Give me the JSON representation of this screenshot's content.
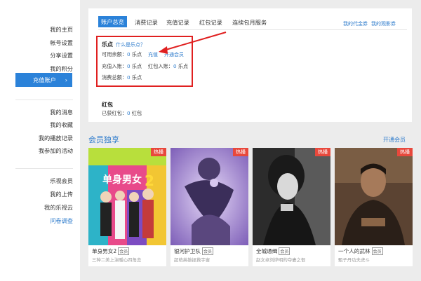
{
  "sidebar": {
    "group1": [
      "我的主页",
      "帐号设置",
      "分享设置",
      "我的积分"
    ],
    "active": "充值账户",
    "group2": [
      "我的消息",
      "我的收藏",
      "我的播放记录",
      "我参加的活动"
    ],
    "group3": [
      "乐视会员",
      "我的上传",
      "我的乐视云",
      "问卷调查"
    ]
  },
  "tabs": [
    "账户总览",
    "消费记录",
    "充值记录",
    "红包记录",
    "连续包月服务"
  ],
  "right_links": [
    "我的代金券",
    "我的观影券"
  ],
  "ledian": {
    "title": "乐点",
    "what": "什么是乐点？",
    "avail_label": "可用余额：",
    "avail_value": "0",
    "unit": "乐点",
    "recharge": "充值",
    "open_vip": "开通会员",
    "recharge_in_label": "充值入账：",
    "recharge_in_value": "0",
    "hongbao_in_label": "红包入账：",
    "hongbao_in_value": "0",
    "consume_label": "消费总额：",
    "consume_value": "0"
  },
  "hongbao": {
    "title": "红包",
    "got_label": "已获红包：",
    "got_value": "0",
    "unit": "红包"
  },
  "vip": {
    "title": "会员独享",
    "link": "开通会员",
    "hot": "热播",
    "member": "会员",
    "posters": [
      {
        "title": "单身男女2",
        "sub": "三种二美上演暧心四角恋"
      },
      {
        "title": "银河护卫队",
        "sub": "超萌英雄拯救宇宙"
      },
      {
        "title": "全城通缉",
        "sub": "赵文卓刘烨明的夺妻之恨"
      },
      {
        "title": "一个人的武林",
        "sub": "甄子丹功夫虎斗"
      }
    ]
  }
}
